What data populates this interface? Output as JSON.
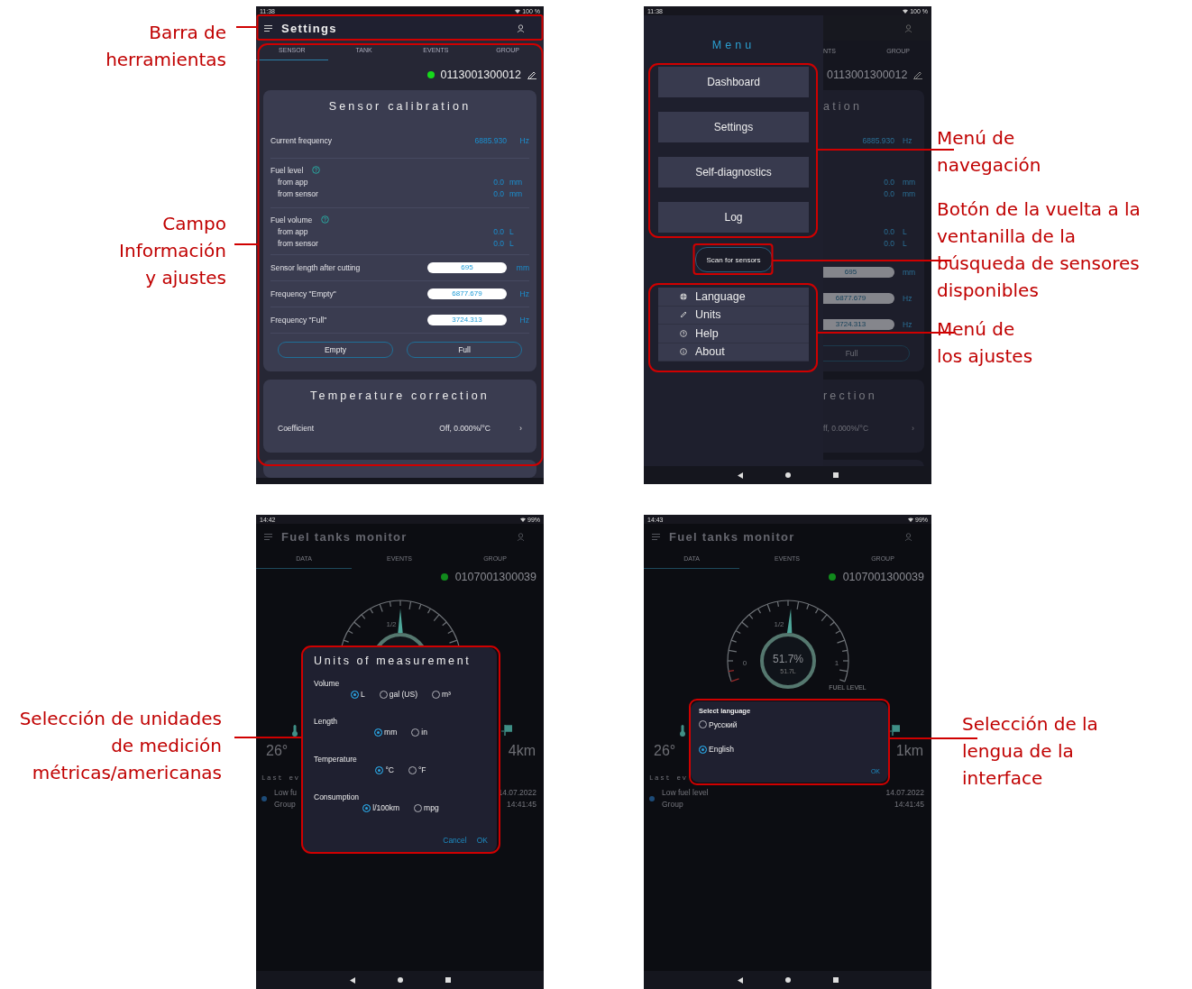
{
  "callouts": {
    "top_left": [
      "Barra de\nherramientas",
      "Campo\nInformación\ny ajustes"
    ],
    "top_right": [
      "Menú de\nnavegación",
      "Botón de la vuelta a la\nventanilla de la\nbúsqueda de sensores\ndisponibles",
      "Menú de\nlos ajustes"
    ],
    "bottom_left": [
      "Selección de unidades\nde medición\nmétricas/americanas"
    ],
    "bottom_right": [
      "Selección de la\nlengua de la\ninterface"
    ]
  },
  "settings_screen": {
    "status_bar": {
      "time": "11:38",
      "battery": "100 %"
    },
    "toolbar": {
      "title": "Settings"
    },
    "tabs": [
      {
        "label": "SENSOR",
        "selected": true
      },
      {
        "label": "TANK",
        "selected": false
      },
      {
        "label": "EVENTS",
        "selected": false
      },
      {
        "label": "GROUP",
        "selected": false
      }
    ],
    "sensor": {
      "id": "0113001300012",
      "connected": true
    },
    "calibration": {
      "title": "Sensor calibration",
      "current_frequency": {
        "label": "Current frequency",
        "value": "6885.930",
        "unit": "Hz"
      },
      "groups": [
        {
          "label": "Fuel level",
          "rows": [
            {
              "label": "from app",
              "value": "0.0",
              "unit": "mm"
            },
            {
              "label": "from sensor",
              "value": "0.0",
              "unit": "mm"
            }
          ]
        },
        {
          "label": "Fuel volume",
          "rows": [
            {
              "label": "from app",
              "value": "0.0",
              "unit": "L"
            },
            {
              "label": "from sensor",
              "value": "0.0",
              "unit": "L"
            }
          ]
        }
      ],
      "inputs": [
        {
          "label": "Sensor length after cutting",
          "value": "695",
          "unit": "mm"
        },
        {
          "label": "Frequency \"Empty\"",
          "value": "6877.679",
          "unit": "Hz"
        },
        {
          "label": "Frequency \"Full\"",
          "value": "3724.313",
          "unit": "Hz"
        }
      ],
      "buttons": [
        "Empty",
        "Full"
      ]
    },
    "temperature": {
      "title": "Temperature correction",
      "label": "Coefficient",
      "value": "Off, 0.000%/°C",
      "chevron": "›"
    }
  },
  "menu_screen": {
    "status_bar": {
      "time": "11:38",
      "battery": "100 %"
    },
    "drawer": {
      "title": "Menu",
      "nav_items": [
        "Dashboard",
        "Settings",
        "Self-diagnostics",
        "Log"
      ],
      "scan_button": "Scan for sensors",
      "settings_items": [
        "Language",
        "Units",
        "Help",
        "About"
      ]
    },
    "background": {
      "tabs": [
        "NTS",
        "GROUP"
      ],
      "sensor_id": "0113001300012",
      "card_title": "ation",
      "frequency": {
        "value": "6885.930",
        "unit": "Hz"
      },
      "readings": [
        {
          "value": "0.0",
          "unit": "mm"
        },
        {
          "value": "0.0",
          "unit": "mm"
        },
        {
          "value": "0.0",
          "unit": "L"
        },
        {
          "value": "0.0",
          "unit": "L"
        }
      ],
      "inputs": [
        {
          "value": "695",
          "unit": "mm"
        },
        {
          "value": "6877.679",
          "unit": "Hz"
        },
        {
          "value": "3724.313",
          "unit": "Hz"
        }
      ],
      "button": "Full",
      "card2_title": "rection",
      "coefficient": "ff, 0.000%/°C",
      "chevron": "›"
    }
  },
  "units_screen": {
    "status_bar": {
      "time": "14:42",
      "battery": "99%"
    },
    "toolbar": {
      "title": "Fuel tanks monitor"
    },
    "tabs": [
      {
        "label": "DATA",
        "selected": true
      },
      {
        "label": "EVENTS",
        "selected": false
      },
      {
        "label": "GROUP",
        "selected": false
      }
    ],
    "sensor": {
      "id": "0107001300039",
      "connected": true
    },
    "gauge": {
      "level": 0.5,
      "top_label": "1/2"
    },
    "temperature": "26°",
    "distance": "4km",
    "events": {
      "title": "Last ev",
      "text": "Low fu",
      "group": "Group",
      "date": "14.07.2022",
      "time": "14:41:45"
    },
    "dialog": {
      "title": "Units of measurement",
      "groups": [
        {
          "label": "Volume",
          "options": [
            {
              "label": "L",
              "selected": true
            },
            {
              "label": "gal (US)",
              "selected": false
            },
            {
              "label": "m³",
              "selected": false
            }
          ]
        },
        {
          "label": "Length",
          "options": [
            {
              "label": "mm",
              "selected": true
            },
            {
              "label": "in",
              "selected": false
            }
          ]
        },
        {
          "label": "Temperature",
          "options": [
            {
              "label": "°C",
              "selected": true
            },
            {
              "label": "°F",
              "selected": false
            }
          ]
        },
        {
          "label": "Consumption",
          "options": [
            {
              "label": "l/100km",
              "selected": true
            },
            {
              "label": "mpg",
              "selected": false
            }
          ]
        }
      ],
      "buttons": [
        "Cancel",
        "OK"
      ]
    }
  },
  "language_screen": {
    "status_bar": {
      "time": "14:43",
      "battery": "99%"
    },
    "toolbar": {
      "title": "Fuel tanks monitor"
    },
    "tabs": [
      {
        "label": "DATA",
        "selected": true
      },
      {
        "label": "EVENTS",
        "selected": false
      },
      {
        "label": "GROUP",
        "selected": false
      }
    ],
    "sensor": {
      "id": "0107001300039",
      "connected": true
    },
    "gauge": {
      "level": 0.517,
      "top_label": "1/2",
      "min_label": "0",
      "max_label": "1",
      "caption": "FUEL LEVEL",
      "reading": "51.7%",
      "sub_reading": "51.7L"
    },
    "temperature": "26°",
    "distance": "1km",
    "events": {
      "title": "Last ev",
      "text": "Low fuel level",
      "group": "Group",
      "date": "14.07.2022",
      "time": "14:41:45"
    },
    "dialog": {
      "title": "Select language",
      "options": [
        {
          "label": "Русский",
          "selected": false
        },
        {
          "label": "English",
          "selected": true
        }
      ],
      "button": "OK"
    }
  }
}
